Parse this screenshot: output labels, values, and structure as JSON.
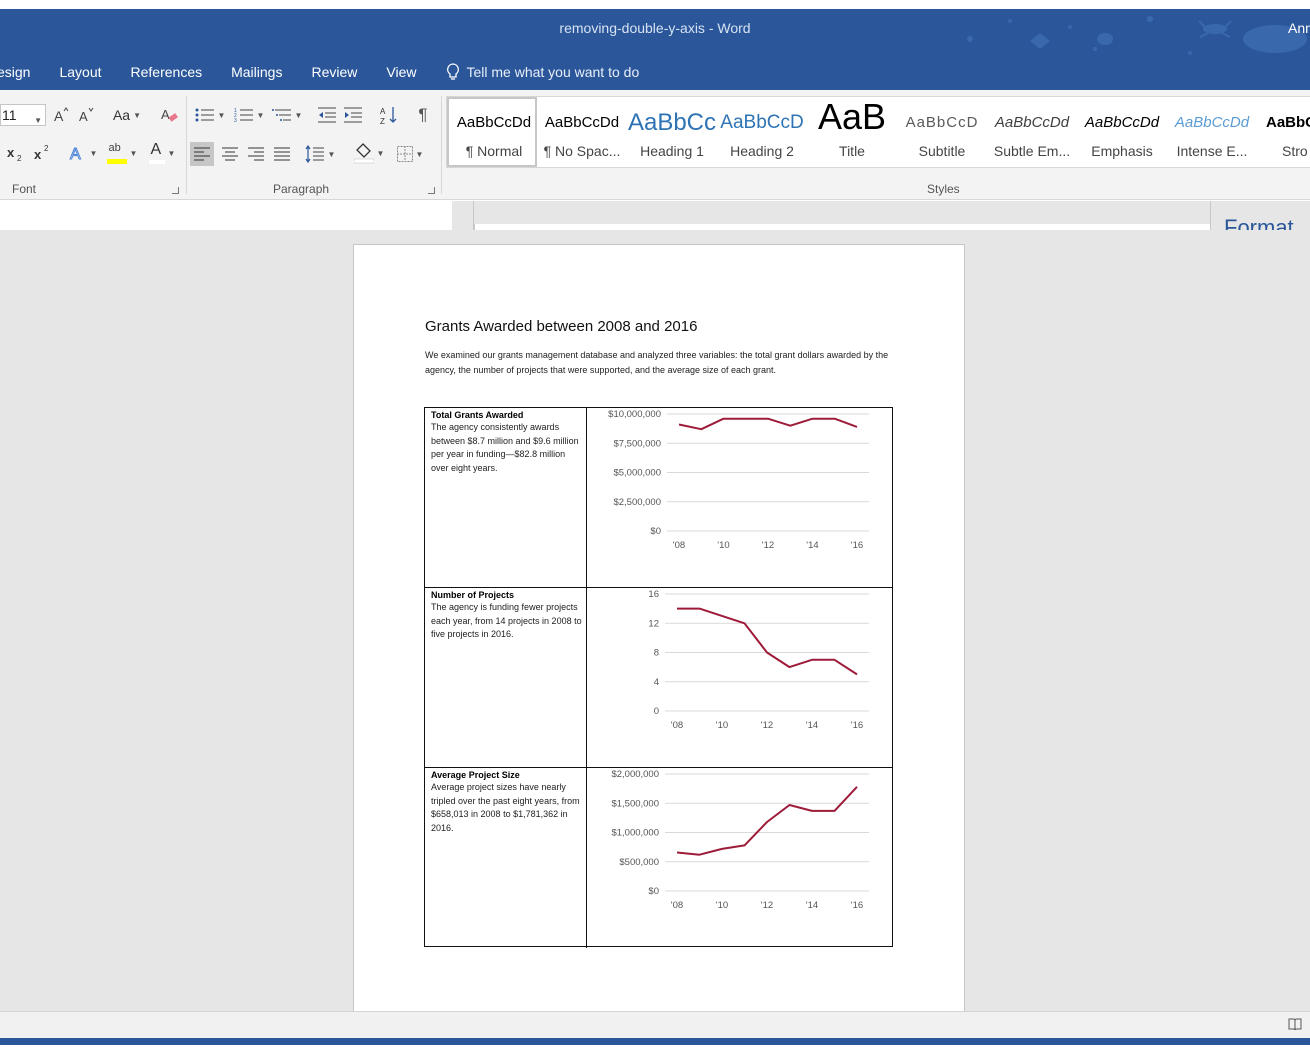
{
  "window": {
    "title": "removing-double-y-axis - Word",
    "user": "Ann"
  },
  "menu": {
    "tabs": [
      "esign",
      "Layout",
      "References",
      "Mailings",
      "Review",
      "View"
    ],
    "tell_me": "Tell me what you want to do"
  },
  "ribbon": {
    "font_size": "11",
    "change_case_label": "Aa",
    "highlight_label": "ab",
    "font_color_label": "A",
    "font_group_label": "Font",
    "paragraph_group_label": "Paragraph",
    "styles_group_label": "Styles",
    "styles": [
      {
        "sample": "AaBbCcDd",
        "name": "¶ Normal"
      },
      {
        "sample": "AaBbCcDd",
        "name": "¶ No Spac..."
      },
      {
        "sample": "AaBbCc",
        "name": "Heading 1"
      },
      {
        "sample": "AaBbCcD",
        "name": "Heading 2"
      },
      {
        "sample": "AaB",
        "name": "Title"
      },
      {
        "sample": "AaBbCcD",
        "name": "Subtitle"
      },
      {
        "sample": "AaBbCcDd",
        "name": "Subtle Em..."
      },
      {
        "sample": "AaBbCcDd",
        "name": "Emphasis"
      },
      {
        "sample": "AaBbCcDd",
        "name": "Intense E..."
      },
      {
        "sample": "AaBbC",
        "name": "Stro"
      }
    ],
    "selected_style": "¶ Normal",
    "accent_color": "#2b579a"
  },
  "format_pane": {
    "title": "Format"
  },
  "document": {
    "heading": "Grants Awarded between 2008 and 2016",
    "intro": "We examined our grants management database and analyzed three variables: the total grant dollars awarded by the agency, the number of projects that were supported, and the average size of each grant.",
    "rows": [
      {
        "heading": "Total Grants Awarded",
        "body": "The agency consistently awards between $8.7 million and $9.6 million per year in funding—$82.8 million over eight years."
      },
      {
        "heading": "Number of Projects",
        "body": "The agency is funding fewer projects each year, from 14 projects in 2008 to five projects in 2016."
      },
      {
        "heading": "Average Project Size",
        "body": "Average project sizes have nearly tripled over the past eight years, from $658,013 in 2008 to $1,781,362 in 2016."
      }
    ]
  },
  "chart_data": [
    {
      "type": "line",
      "x": [
        2008,
        2009,
        2010,
        2011,
        2012,
        2013,
        2014,
        2015,
        2016
      ],
      "x_tick_labels": [
        "'08",
        "'10",
        "'12",
        "'14",
        "'16"
      ],
      "x_tick_values": [
        2008,
        2010,
        2012,
        2014,
        2016
      ],
      "y_tick_labels": [
        "$0",
        "$2,500,000",
        "$5,000,000",
        "$7,500,000",
        "$10,000,000"
      ],
      "y_tick_values": [
        0,
        2500000,
        5000000,
        7500000,
        10000000
      ],
      "ylim": [
        0,
        10000000
      ],
      "series": [
        {
          "values": [
            9100000,
            8700000,
            9600000,
            9600000,
            9600000,
            9000000,
            9600000,
            9600000,
            8900000
          ],
          "color": "#9e1b3a"
        }
      ],
      "grid": true
    },
    {
      "type": "line",
      "x": [
        2008,
        2009,
        2010,
        2011,
        2012,
        2013,
        2014,
        2015,
        2016
      ],
      "x_tick_labels": [
        "'08",
        "'10",
        "'12",
        "'14",
        "'16"
      ],
      "x_tick_values": [
        2008,
        2010,
        2012,
        2014,
        2016
      ],
      "y_tick_labels": [
        "0",
        "4",
        "8",
        "12",
        "16"
      ],
      "y_tick_values": [
        0,
        4,
        8,
        12,
        16
      ],
      "ylim": [
        0,
        16
      ],
      "series": [
        {
          "values": [
            14,
            14,
            13,
            12,
            8,
            6,
            7,
            7,
            5
          ],
          "color": "#9e1b3a"
        }
      ],
      "grid": true
    },
    {
      "type": "line",
      "x": [
        2008,
        2009,
        2010,
        2011,
        2012,
        2013,
        2014,
        2015,
        2016
      ],
      "x_tick_labels": [
        "'08",
        "'10",
        "'12",
        "'14",
        "'16"
      ],
      "x_tick_values": [
        2008,
        2010,
        2012,
        2014,
        2016
      ],
      "y_tick_labels": [
        "$0",
        "$500,000",
        "$1,000,000",
        "$1,500,000",
        "$2,000,000"
      ],
      "y_tick_values": [
        0,
        500000,
        1000000,
        1500000,
        2000000
      ],
      "ylim": [
        0,
        2000000
      ],
      "series": [
        {
          "values": [
            658013,
            620000,
            720000,
            780000,
            1180000,
            1470000,
            1370000,
            1370000,
            1781362
          ],
          "color": "#9e1b3a"
        }
      ],
      "grid": true
    }
  ]
}
